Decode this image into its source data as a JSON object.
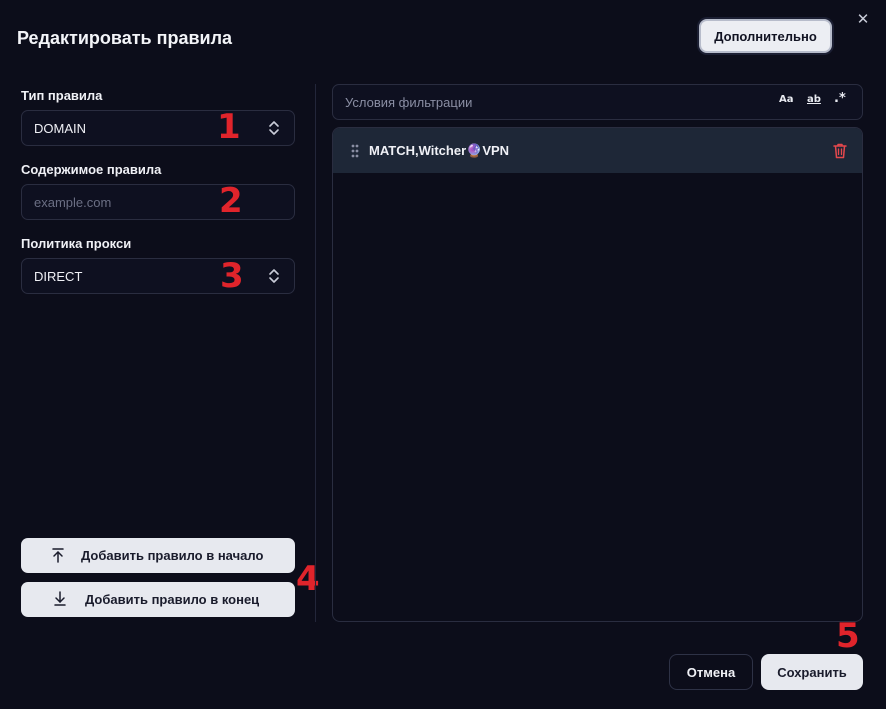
{
  "dialog": {
    "title": "Редактировать правила",
    "advanced_label": "Дополнительно",
    "close_symbol": "✕"
  },
  "form": {
    "rule_type_label": "Тип правила",
    "rule_type_value": "DOMAIN",
    "rule_content_label": "Содержимое правила",
    "rule_content_placeholder": "example.com",
    "proxy_policy_label": "Политика прокси",
    "proxy_policy_value": "DIRECT"
  },
  "side_actions": {
    "prepend_label": "Добавить правило в начало",
    "append_label": "Добавить правило в конец"
  },
  "filter": {
    "placeholder": "Условия фильтрации",
    "match_case_symbol": "Aa",
    "whole_word_symbol": "ab",
    "regex_symbol": ".*"
  },
  "rules": [
    {
      "text": "MATCH,Witcher🔮VPN"
    }
  ],
  "annotations": {
    "n1": "1",
    "n2": "2",
    "n3": "3",
    "n4": "4",
    "n5": "5"
  },
  "footer": {
    "cancel_label": "Отмена",
    "save_label": "Сохранить"
  },
  "colors": {
    "background": "#0c0d1a",
    "annotation_red": "#e0242b",
    "rule_row": "#1e2737",
    "delete_icon": "#e5484d"
  }
}
